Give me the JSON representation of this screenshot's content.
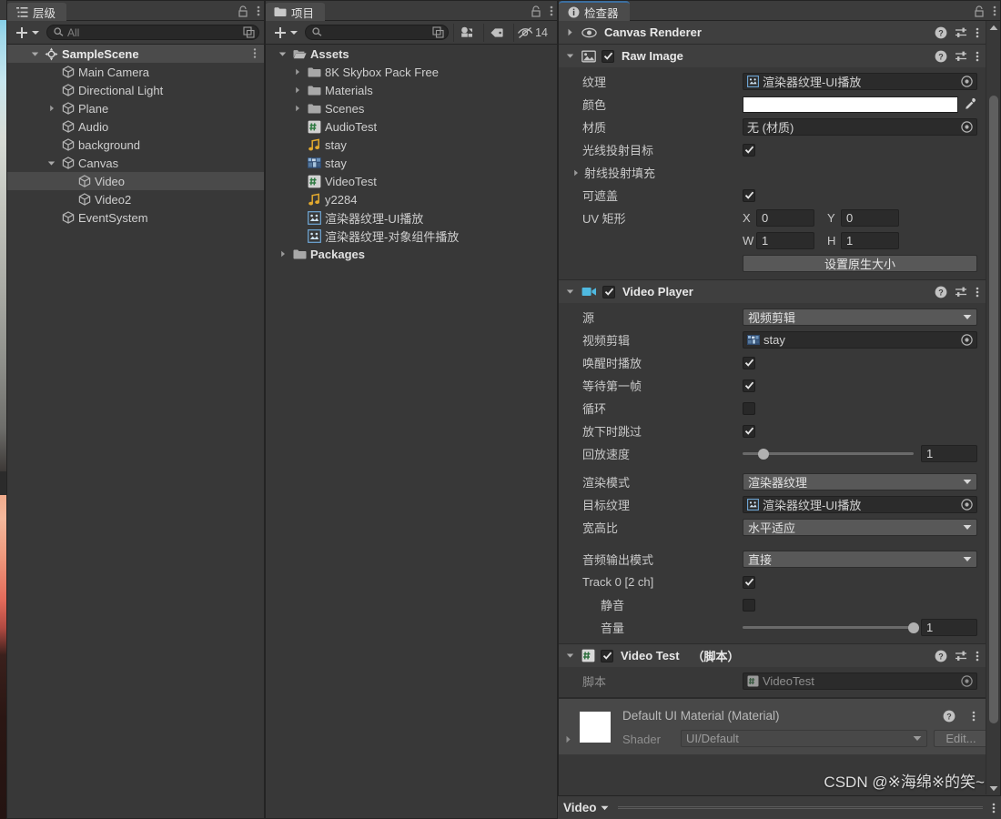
{
  "hierarchy": {
    "tab_label": "层级",
    "tab_icon": "hierarchy-icon",
    "toolbar": {
      "add_label": "+",
      "search_placeholder": "All",
      "search_value": ""
    },
    "items": [
      {
        "label": "SampleScene",
        "depth": 0,
        "foldout": "open",
        "icon": "scene-icon",
        "selected": false,
        "scene": true
      },
      {
        "label": "Main Camera",
        "depth": 1,
        "foldout": "none",
        "icon": "cube-icon",
        "selected": false,
        "scene": false
      },
      {
        "label": "Directional Light",
        "depth": 1,
        "foldout": "none",
        "icon": "cube-icon",
        "selected": false,
        "scene": false
      },
      {
        "label": "Plane",
        "depth": 1,
        "foldout": "closed",
        "icon": "cube-icon",
        "selected": false,
        "scene": false
      },
      {
        "label": "Audio",
        "depth": 1,
        "foldout": "none",
        "icon": "cube-icon",
        "selected": false,
        "scene": false
      },
      {
        "label": "background",
        "depth": 1,
        "foldout": "none",
        "icon": "cube-icon",
        "selected": false,
        "scene": false
      },
      {
        "label": "Canvas",
        "depth": 1,
        "foldout": "open",
        "icon": "cube-icon",
        "selected": false,
        "scene": false
      },
      {
        "label": "Video",
        "depth": 2,
        "foldout": "none",
        "icon": "cube-icon",
        "selected": true,
        "scene": false
      },
      {
        "label": "Video2",
        "depth": 2,
        "foldout": "none",
        "icon": "cube-icon",
        "selected": false,
        "scene": false
      },
      {
        "label": "EventSystem",
        "depth": 1,
        "foldout": "none",
        "icon": "cube-icon",
        "selected": false,
        "scene": false
      }
    ]
  },
  "project": {
    "tab_label": "项目",
    "tab_icon": "folder-icon",
    "toolbar": {
      "add_label": "+",
      "search_placeholder": "",
      "search_value": "",
      "packages_icon": "packages-filter-icon",
      "label_icon": "tag-icon",
      "hidden_icon": "hidden-eye-icon",
      "hidden_count": "14"
    },
    "items": [
      {
        "label": "Assets",
        "depth": 0,
        "foldout": "open",
        "icon": "folder-open-icon",
        "bold": true
      },
      {
        "label": "8K Skybox Pack Free",
        "depth": 1,
        "foldout": "closed",
        "icon": "folder-icon",
        "bold": false
      },
      {
        "label": "Materials",
        "depth": 1,
        "foldout": "closed",
        "icon": "folder-icon",
        "bold": false
      },
      {
        "label": "Scenes",
        "depth": 1,
        "foldout": "closed",
        "icon": "folder-icon",
        "bold": false
      },
      {
        "label": "AudioTest",
        "depth": 1,
        "foldout": "none",
        "icon": "csharp-script-icon",
        "bold": false
      },
      {
        "label": "stay",
        "depth": 1,
        "foldout": "none",
        "icon": "audio-clip-icon",
        "bold": false
      },
      {
        "label": "stay",
        "depth": 1,
        "foldout": "none",
        "icon": "video-clip-icon",
        "bold": false
      },
      {
        "label": "VideoTest",
        "depth": 1,
        "foldout": "none",
        "icon": "csharp-script-icon",
        "bold": false
      },
      {
        "label": "y2284",
        "depth": 1,
        "foldout": "none",
        "icon": "audio-clip-icon",
        "bold": false
      },
      {
        "label": "渲染器纹理-UI播放",
        "depth": 1,
        "foldout": "none",
        "icon": "render-texture-icon",
        "bold": false
      },
      {
        "label": "渲染器纹理-对象组件播放",
        "depth": 1,
        "foldout": "none",
        "icon": "render-texture-icon",
        "bold": false
      },
      {
        "label": "Packages",
        "depth": 0,
        "foldout": "closed",
        "icon": "folder-icon",
        "bold": true
      }
    ]
  },
  "inspector": {
    "tab_label": "检查器",
    "tab_icon": "info-icon",
    "components": [
      {
        "name": "Canvas Renderer",
        "icon": "canvas-renderer-icon",
        "collapsed": true,
        "has_enable_checkbox": false
      },
      {
        "name": "Raw Image",
        "icon": "raw-image-icon",
        "collapsed": false,
        "has_enable_checkbox": true,
        "enabled": true
      },
      {
        "name": "Video Player",
        "icon": "video-player-icon",
        "collapsed": false,
        "has_enable_checkbox": true,
        "enabled": true
      },
      {
        "name": "Video Test",
        "suffix": "（脚本）",
        "icon": "csharp-script-icon",
        "collapsed": false,
        "has_enable_checkbox": true,
        "enabled": true
      }
    ],
    "raw_image": {
      "texture_label": "纹理",
      "texture_value": "渲染器纹理-UI播放",
      "texture_icon": "render-texture-icon",
      "color_label": "颜色",
      "color_value": "#ffffff",
      "material_label": "材质",
      "material_value": "无 (材质)",
      "raycast_target_label": "光线投射目标",
      "raycast_target_value": true,
      "raycast_padding_label": "射线投射填充",
      "maskable_label": "可遮盖",
      "maskable_value": true,
      "uv_rect_label": "UV 矩形",
      "uv_x_label": "X",
      "uv_x_value": "0",
      "uv_y_label": "Y",
      "uv_y_value": "0",
      "uv_w_label": "W",
      "uv_w_value": "1",
      "uv_h_label": "H",
      "uv_h_value": "1",
      "set_native_size_label": "设置原生大小"
    },
    "video_player": {
      "source_label": "源",
      "source_value": "视频剪辑",
      "clip_label": "视频剪辑",
      "clip_value": "stay",
      "clip_icon": "video-clip-icon",
      "play_on_awake_label": "唤醒时播放",
      "play_on_awake_value": true,
      "wait_first_frame_label": "等待第一帧",
      "wait_first_frame_value": true,
      "loop_label": "循环",
      "loop_value": false,
      "skip_on_drop_label": "放下时跳过",
      "skip_on_drop_value": true,
      "playback_speed_label": "回放速度",
      "playback_speed_value": "1",
      "playback_speed_fraction": 0.12,
      "render_mode_label": "渲染模式",
      "render_mode_value": "渲染器纹理",
      "target_texture_label": "目标纹理",
      "target_texture_value": "渲染器纹理-UI播放",
      "target_texture_icon": "render-texture-icon",
      "aspect_ratio_label": "宽高比",
      "aspect_ratio_value": "水平适应",
      "audio_output_mode_label": "音频输出模式",
      "audio_output_mode_value": "直接",
      "track0_label": "Track 0 [2 ch]",
      "track0_value": true,
      "mute_label": "静音",
      "mute_value": false,
      "volume_label": "音量",
      "volume_value": "1",
      "volume_fraction": 1.0
    },
    "video_test": {
      "script_label": "脚本",
      "script_value": "VideoTest",
      "script_icon": "csharp-script-icon"
    },
    "material_preview": {
      "title": "Default UI Material (Material)",
      "shader_label": "Shader",
      "shader_value": "UI/Default",
      "edit_label": "Edit..."
    }
  },
  "bottom_bar": {
    "tab_label": "Video"
  },
  "watermark": "CSDN @※海绵※的笑~",
  "colors": {
    "panel_bg": "#383838",
    "component_header": "#3f3f3f",
    "tab_bg": "#4b4b4b",
    "selection": "#4a4a4a",
    "accent_blue": "#3c6e9e",
    "field_bg": "#2b2b2b",
    "dropdown_bg": "#585858"
  }
}
